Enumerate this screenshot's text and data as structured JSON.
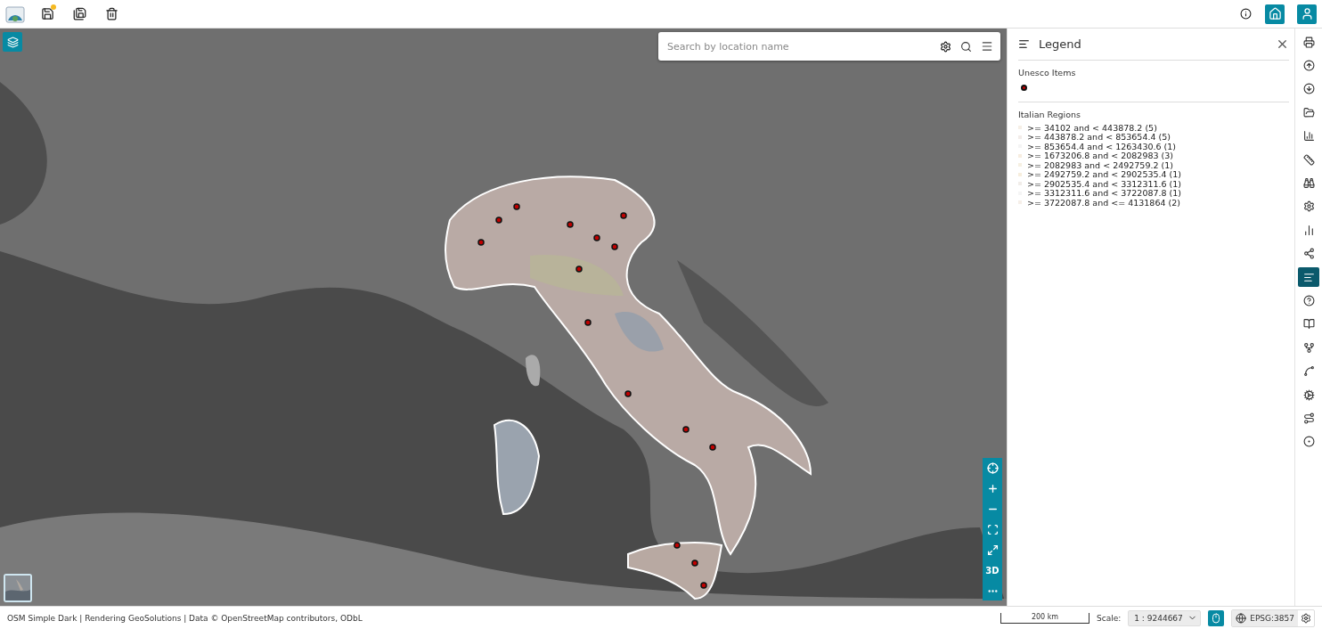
{
  "top_bar": {
    "tools": [
      {
        "kind": "save-new",
        "badge": true
      },
      {
        "kind": "save-as",
        "badge": false
      },
      {
        "kind": "delete",
        "badge": false
      }
    ],
    "right": [
      {
        "kind": "info"
      },
      {
        "kind": "home"
      },
      {
        "kind": "user"
      }
    ]
  },
  "map": {
    "search": {
      "placeholder": "Search by location name"
    },
    "controls": [
      {
        "kind": "locate"
      },
      {
        "kind": "zoom-in"
      },
      {
        "kind": "zoom-out"
      },
      {
        "kind": "extent"
      },
      {
        "kind": "fullscreen"
      },
      {
        "kind": "text",
        "label": "3D"
      },
      {
        "kind": "more"
      }
    ]
  },
  "legend": {
    "title": "Legend",
    "layers": [
      {
        "name": "Unesco Items",
        "kind": "point"
      },
      {
        "name": "Italian Regions",
        "kind": "ranges",
        "items": [
          {
            "label": ">= 34102 and < 443878.2 (5)",
            "color": "#f6efe6"
          },
          {
            "label": ">= 443878.2 and < 853654.4 (5)",
            "color": "#f2ece9"
          },
          {
            "label": ">= 853654.4 and < 1263430.6 (1)",
            "color": "#f4f4f4"
          },
          {
            "label": ">= 1673206.8 and < 2082983 (3)",
            "color": "#f7ede0"
          },
          {
            "label": ">= 2082983 and < 2492759.2 (1)",
            "color": "#f6f0e2"
          },
          {
            "label": ">= 2492759.2 and < 2902535.4 (1)",
            "color": "#f7eedd"
          },
          {
            "label": ">= 2902535.4 and < 3312311.6 (1)",
            "color": "#f1ede9"
          },
          {
            "label": ">= 3312311.6 and < 3722087.8 (1)",
            "color": "#f5f5f5"
          },
          {
            "label": ">= 3722087.8 and <= 4131864 (2)",
            "color": "#f6efe8"
          }
        ]
      }
    ]
  },
  "toolbar": [
    {
      "selected": false
    },
    {
      "selected": false
    },
    {
      "selected": false
    },
    {
      "selected": false
    },
    {
      "selected": false
    },
    {
      "selected": false
    },
    {
      "selected": false
    },
    {
      "selected": false
    },
    {
      "selected": false
    },
    {
      "selected": false
    },
    {
      "selected": true
    },
    {
      "selected": false
    },
    {
      "selected": false
    },
    {
      "selected": false
    },
    {
      "selected": false
    },
    {
      "selected": false
    },
    {
      "selected": false
    },
    {
      "selected": false
    }
  ],
  "status_bar": {
    "attribution": "OSM Simple Dark | Rendering GeoSolutions | Data © OpenStreetMap contributors, ODbL",
    "scale_bar": "200 km",
    "scale_label": "Scale:",
    "scale_value": "1 : 9244667",
    "crs": "EPSG:3857"
  }
}
